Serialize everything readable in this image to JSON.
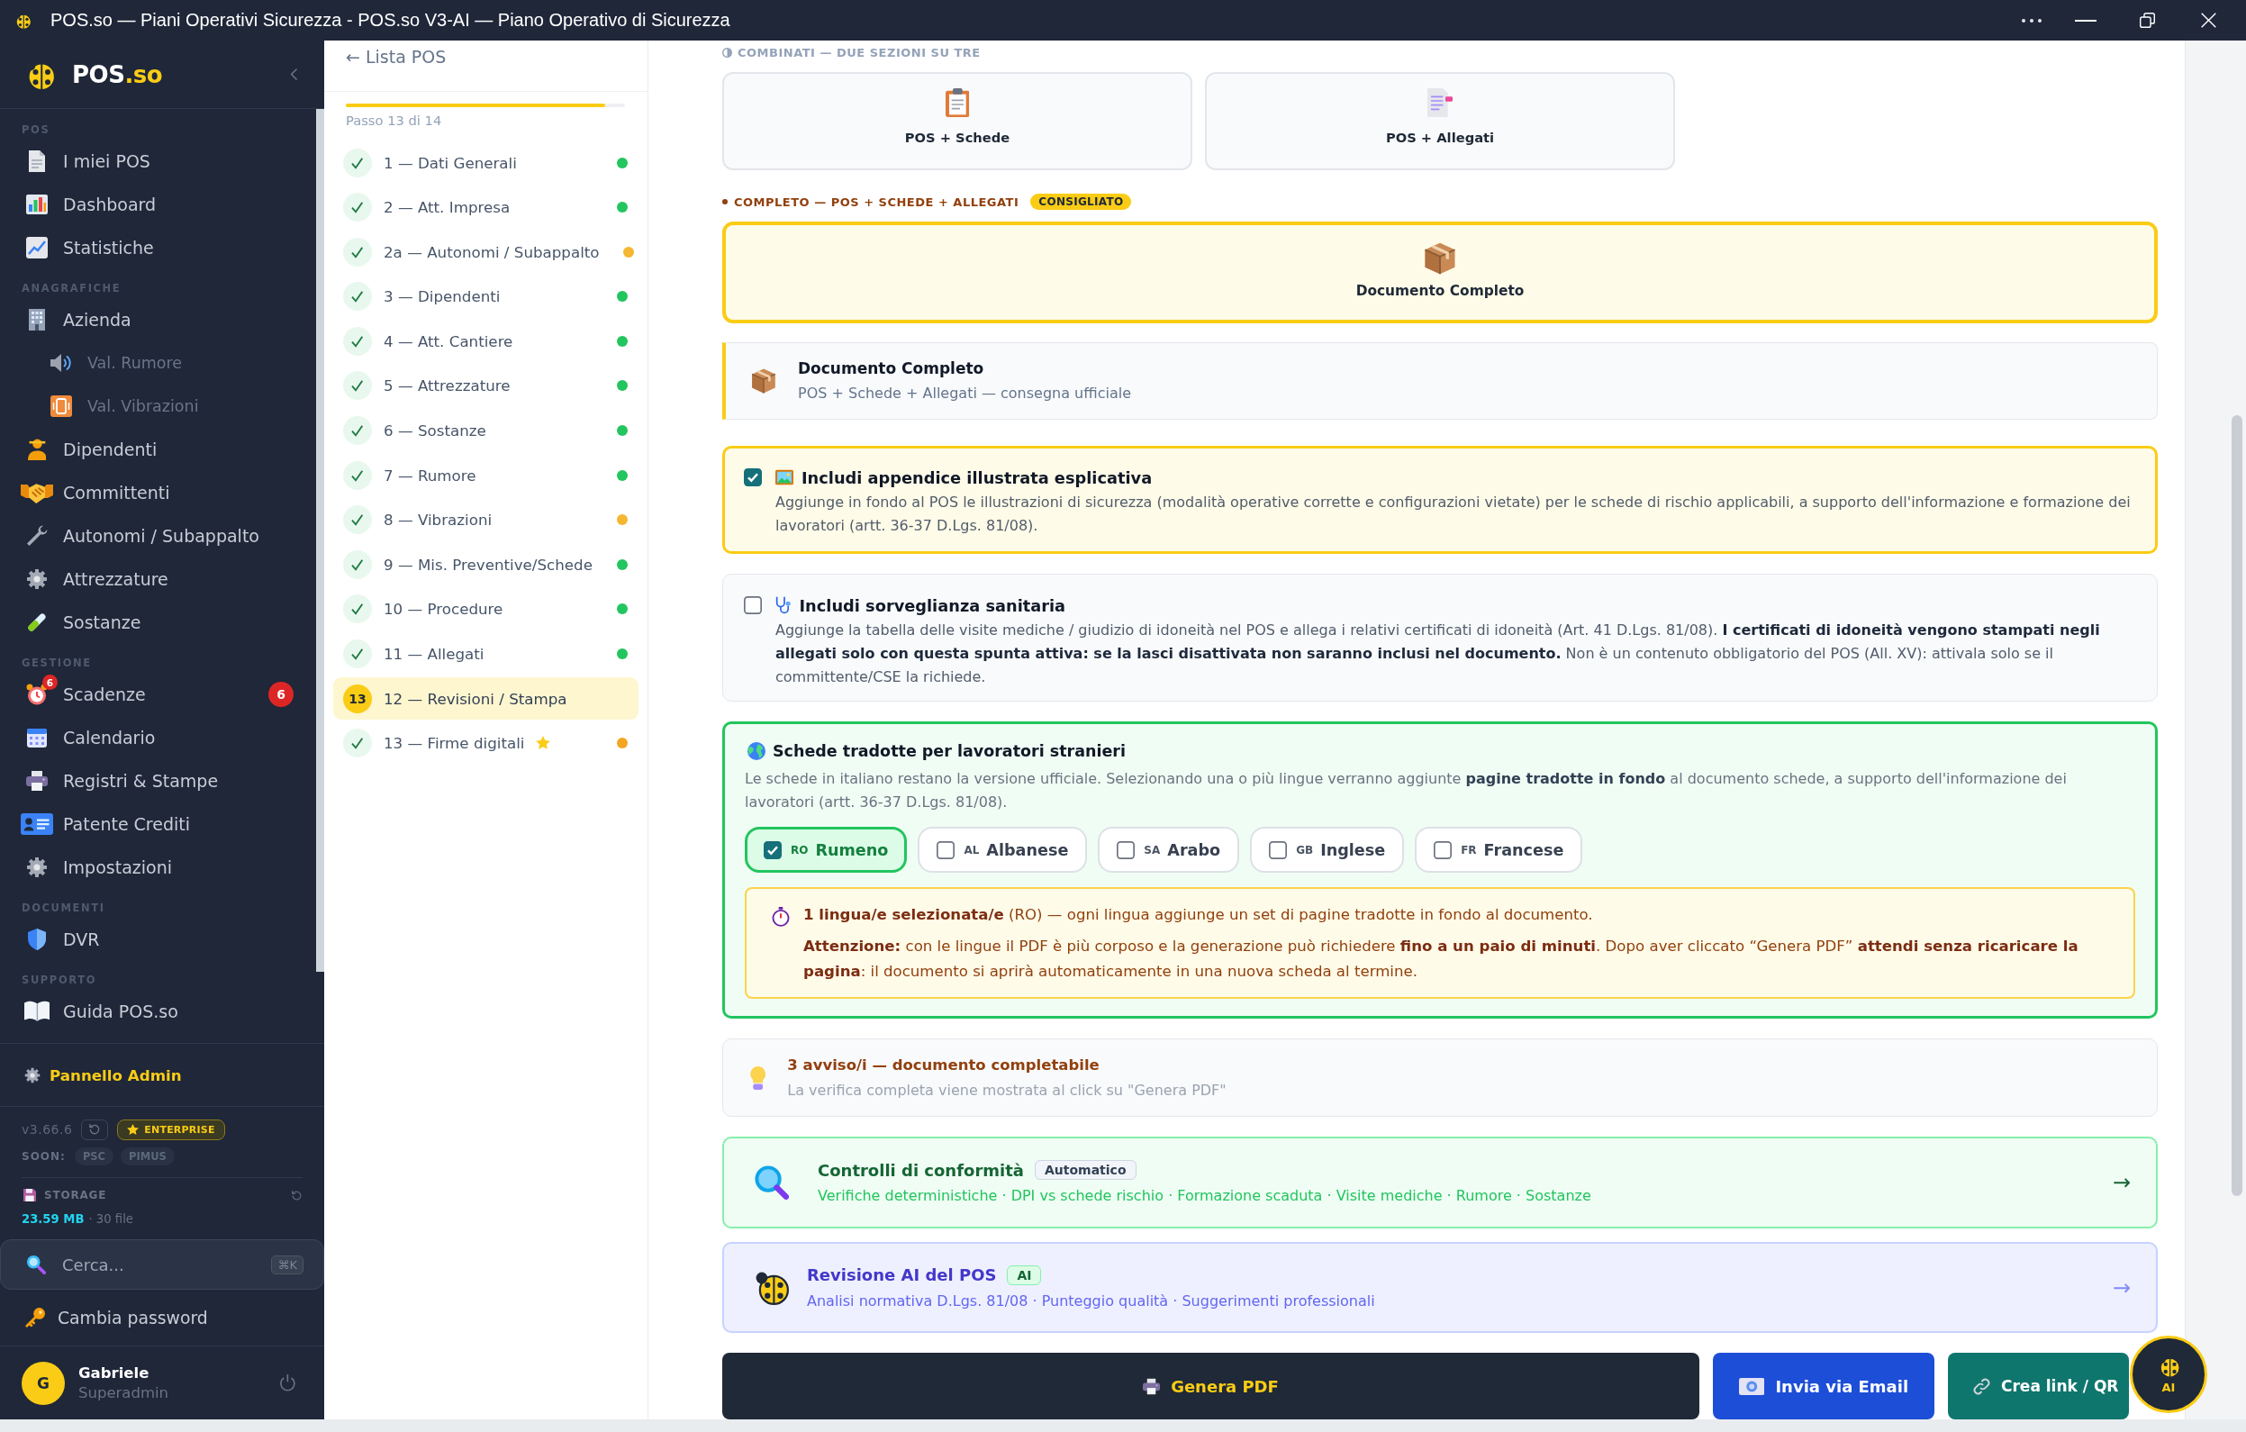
{
  "window": {
    "title": "POS.so — Piani Operativi Sicurezza - POS.so V3-AI — Piano Operativo di Sicurezza"
  },
  "sidebar": {
    "logo": {
      "name": "POS",
      "suffix": ".so"
    },
    "sections": [
      {
        "heading": "POS",
        "items": [
          {
            "label": "I miei POS",
            "selected": false
          },
          {
            "label": "Dashboard",
            "selected": false
          },
          {
            "label": "Statistiche",
            "selected": false
          }
        ]
      },
      {
        "heading": "ANAGRAFICHE",
        "items": [
          {
            "label": "Azienda",
            "selected": false,
            "children": [
              {
                "label": "Val. Rumore",
                "selected": false
              },
              {
                "label": "Val. Vibrazioni",
                "selected": false
              }
            ]
          },
          {
            "label": "Dipendenti",
            "selected": false
          },
          {
            "label": "Committenti",
            "selected": false
          },
          {
            "label": "Autonomi / Subappalto",
            "selected": false
          },
          {
            "label": "Attrezzature",
            "selected": false
          },
          {
            "label": "Sostanze",
            "selected": false
          }
        ]
      },
      {
        "heading": "GESTIONE",
        "items": [
          {
            "label": "Scadenze",
            "selected": false,
            "icon_badge": "6",
            "count": "6"
          },
          {
            "label": "Calendario",
            "selected": false
          },
          {
            "label": "Registri & Stampe",
            "selected": false
          },
          {
            "label": "Patente Crediti",
            "selected": false
          },
          {
            "label": "Impostazioni",
            "selected": false
          }
        ]
      },
      {
        "heading": "DOCUMENTI",
        "items": [
          {
            "label": "DVR",
            "selected": false
          }
        ]
      },
      {
        "heading": "SUPPORTO",
        "items": [
          {
            "label": "Guida POS.so",
            "selected": false
          }
        ]
      }
    ],
    "admin_link": "Pannello Admin",
    "version": "v3.66.6",
    "plan_badge": "ENTERPRISE",
    "soon": {
      "label": "SOON:",
      "tags": [
        "PSC",
        "PIMUS"
      ]
    },
    "storage": {
      "label": "STORAGE",
      "size": "23.59 MB",
      "files": "· 30 file"
    },
    "search": {
      "placeholder": "Cerca...",
      "shortcut": "⌘K"
    },
    "change_password": "Cambia password",
    "user": {
      "initial": "G",
      "name": "Gabriele",
      "role": "Superadmin"
    }
  },
  "steps_panel": {
    "back": "← Lista POS",
    "progress": {
      "level": 0.93
    },
    "progress_label": "Passo 13 di 14",
    "steps": [
      {
        "label": "1 — Dati Generali",
        "done": true,
        "selected": false,
        "starred": false,
        "color": "#22c55e"
      },
      {
        "label": "2 — Att. Impresa",
        "done": true,
        "selected": false,
        "starred": false,
        "color": "#22c55e"
      },
      {
        "label": "2a — Autonomi / Subappalto",
        "done": true,
        "selected": false,
        "starred": false,
        "color": "#f5b731"
      },
      {
        "label": "3 — Dipendenti",
        "done": true,
        "selected": false,
        "starred": false,
        "color": "#22c55e"
      },
      {
        "label": "4 — Att. Cantiere",
        "done": true,
        "selected": false,
        "starred": false,
        "color": "#22c55e"
      },
      {
        "label": "5 — Attrezzature",
        "done": true,
        "selected": false,
        "starred": false,
        "color": "#22c55e"
      },
      {
        "label": "6 — Sostanze",
        "done": true,
        "selected": false,
        "starred": false,
        "color": "#22c55e"
      },
      {
        "label": "7 — Rumore",
        "done": true,
        "selected": false,
        "starred": false,
        "color": "#22c55e"
      },
      {
        "label": "8 — Vibrazioni",
        "done": true,
        "selected": false,
        "starred": false,
        "color": "#f5b731"
      },
      {
        "label": "9 — Mis. Preventive/Schede",
        "done": true,
        "selected": false,
        "starred": false,
        "color": "#22c55e"
      },
      {
        "label": "10 — Procedure",
        "done": true,
        "selected": false,
        "starred": false,
        "color": "#22c55e"
      },
      {
        "label": "11 — Allegati",
        "done": true,
        "selected": false,
        "starred": false,
        "color": "#22c55e"
      },
      {
        "label": "12 — Revisioni / Stampa",
        "done": false,
        "selected": true,
        "starred": false,
        "badge": "13"
      },
      {
        "label": "13 — Firme digitali",
        "done": true,
        "selected": false,
        "starred": true,
        "color": "#f5a524"
      }
    ]
  },
  "main": {
    "combined": {
      "heading": "COMBINATI — DUE SEZIONI SU TRE",
      "options": [
        {
          "label": "POS + Schede",
          "selected": false
        },
        {
          "label": "POS + Allegati",
          "selected": false
        }
      ]
    },
    "complete": {
      "heading": "COMPLETO — POS + SCHEDE + ALLEGATI",
      "badge": "CONSIGLIATO",
      "option": {
        "label": "Documento Completo",
        "selected": true
      }
    },
    "summary": {
      "title": "Documento Completo",
      "subtitle": "POS + Schede + Allegati — consegna ufficiale"
    },
    "toggles": [
      {
        "title": "Includi appendice illustrata esplicativa",
        "checked": true,
        "description": "Aggiunge in fondo al POS le illustrazioni di sicurezza (modalità operative corrette e configurazioni vietate) per le schede di rischio applicabili, a supporto dell'informazione e formazione dei lavoratori (artt. 36-37 D.Lgs. 81/08)."
      },
      {
        "title": "Includi sorveglianza sanitaria",
        "checked": false,
        "description": "Aggiunge la tabella delle visite mediche / giudizio di idoneità nel POS e allega i relativi certificati di idoneità (Art. 41 D.Lgs. 81/08). **I certificati di idoneità vengono stampati negli allegati solo con questa spunta attiva: se la lasci disattivata non saranno inclusi nel documento.** Non è un contenuto obbligatorio del POS (All. XV): attivala solo se il committente/CSE la richiede."
      }
    ],
    "translations": {
      "title": "Schede tradotte per lavoratori stranieri",
      "description": "Le schede in italiano restano la versione ufficiale. Selezionando una o più lingue verranno aggiunte **pagine tradotte in fondo** al documento schede, a supporto dell'informazione dei lavoratori (artt. 36-37 D.Lgs. 81/08).",
      "languages": [
        {
          "code": "RO",
          "name": "Rumeno",
          "checked": true
        },
        {
          "code": "AL",
          "name": "Albanese",
          "checked": false
        },
        {
          "code": "SA",
          "name": "Arabo",
          "checked": false
        },
        {
          "code": "GB",
          "name": "Inglese",
          "checked": false
        },
        {
          "code": "FR",
          "name": "Francese",
          "checked": false
        }
      ],
      "notice": [
        "**1 lingua/e selezionata/e** (RO) — ogni lingua aggiunge un set di pagine tradotte in fondo al documento.",
        "**Attenzione:** con le lingue il PDF è più corposo e la generazione può richiedere **fino a un paio di minuti**. Dopo aver cliccato “Genera PDF” **attendi senza ricaricare la pagina**: il documento si aprirà automaticamente in una nuova scheda al termine."
      ]
    },
    "warnings": {
      "title": "3 avviso/i — documento completabile",
      "subtitle": "La verifica completa viene mostrata al click su \"Genera PDF\""
    },
    "tools": [
      {
        "kind": "checks",
        "title": "Controlli di conformità",
        "badge": "Automatico",
        "subtitle": "Verifiche deterministiche · DPI vs schede rischio · Formazione scaduta · Visite mediche · Rumore · Sostanze",
        "arrow": "→"
      },
      {
        "kind": "ai",
        "title": "Revisione AI del POS",
        "badge": "AI",
        "subtitle": "Analisi normativa D.Lgs. 81/08 · Punteggio qualità · Suggerimenti professionali",
        "arrow": "→"
      }
    ],
    "actions": [
      {
        "kind": "primary",
        "label": "Genera PDF"
      },
      {
        "kind": "email",
        "label": "Invia via Email"
      },
      {
        "kind": "link",
        "label": "Crea link / QR"
      }
    ],
    "assistant_button": {
      "label": "AI"
    }
  }
}
